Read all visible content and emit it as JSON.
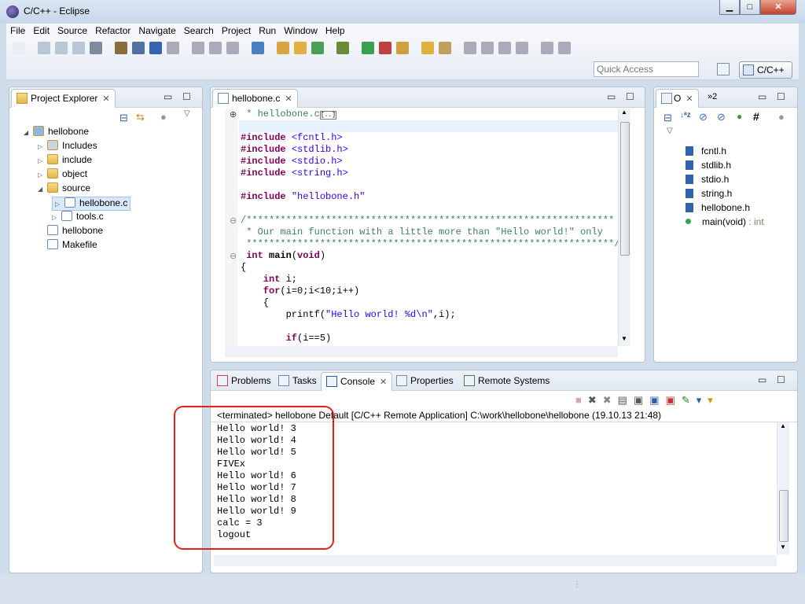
{
  "window": {
    "title": "C/C++ - Eclipse",
    "minimize": "▁",
    "maximize": "□",
    "close": "✕"
  },
  "menu": [
    "File",
    "Edit",
    "Source",
    "Refactor",
    "Navigate",
    "Search",
    "Project",
    "Run",
    "Window",
    "Help"
  ],
  "toolbar": {
    "quick_access_placeholder": "Quick Access",
    "perspective": "C/C++"
  },
  "project_explorer": {
    "tab": "Project Explorer",
    "items": [
      {
        "label": "hellobone",
        "level": 0,
        "expanded": true,
        "icon": "project-icon"
      },
      {
        "label": "Includes",
        "level": 1,
        "expanded": false,
        "icon": "includes-icon"
      },
      {
        "label": "include",
        "level": 1,
        "expanded": false,
        "icon": "folder-icon"
      },
      {
        "label": "object",
        "level": 1,
        "expanded": false,
        "icon": "folder-icon"
      },
      {
        "label": "source",
        "level": 1,
        "expanded": true,
        "icon": "folder-icon"
      },
      {
        "label": "hellobone.c",
        "level": 2,
        "expanded": false,
        "icon": "c-file-icon",
        "selected": true
      },
      {
        "label": "tools.c",
        "level": 2,
        "expanded": false,
        "icon": "c-file-icon"
      },
      {
        "label": "hellobone",
        "level": 1,
        "icon": "binary-icon"
      },
      {
        "label": "Makefile",
        "level": 1,
        "icon": "makefile-icon"
      }
    ]
  },
  "editor": {
    "tab": "hellobone.c",
    "lines": [
      [
        [
          "cm",
          " * hellobone.c"
        ],
        [
          "pl",
          "[..]"
        ]
      ],
      [],
      [
        [
          "pre",
          "#include "
        ],
        [
          "str",
          "<fcntl.h>"
        ]
      ],
      [
        [
          "pre",
          "#include "
        ],
        [
          "str",
          "<stdlib.h>"
        ]
      ],
      [
        [
          "pre",
          "#include "
        ],
        [
          "str",
          "<stdio.h>"
        ]
      ],
      [
        [
          "pre",
          "#include "
        ],
        [
          "str",
          "<string.h>"
        ]
      ],
      [],
      [
        [
          "pre",
          "#include "
        ],
        [
          "str",
          "\"hellobone.h\""
        ]
      ],
      [],
      [
        [
          "cm",
          "/*****************************************************************"
        ]
      ],
      [
        [
          "cm",
          " * Our main function with a little more than \"Hello world!\" only"
        ]
      ],
      [
        [
          "cm",
          " *****************************************************************/"
        ]
      ],
      [
        [
          "kw",
          " int "
        ],
        [
          "fn",
          "main"
        ],
        [
          "pl",
          "("
        ],
        [
          "kw",
          "void"
        ],
        [
          "pl",
          ")"
        ]
      ],
      [
        [
          "pl",
          "{"
        ]
      ],
      [
        [
          "kw",
          "    int "
        ],
        [
          "pl",
          "i;"
        ]
      ],
      [
        [
          "kw",
          "    for"
        ],
        [
          "pl",
          "(i=0;i<10;i++)"
        ]
      ],
      [
        [
          "pl",
          "    {"
        ]
      ],
      [
        [
          "pl",
          "        printf("
        ],
        [
          "str",
          "\"Hello world! %d\\n\""
        ],
        [
          "pl",
          ",i);"
        ]
      ],
      [],
      [
        [
          "kw",
          "        if"
        ],
        [
          "pl",
          "(i==5)"
        ]
      ]
    ]
  },
  "outline": {
    "tab": "O",
    "tab2": "»2",
    "items": [
      {
        "label": "fcntl.h",
        "icon": "include-icon"
      },
      {
        "label": "stdlib.h",
        "icon": "include-icon"
      },
      {
        "label": "stdio.h",
        "icon": "include-icon"
      },
      {
        "label": "string.h",
        "icon": "include-icon"
      },
      {
        "label": "hellobone.h",
        "icon": "include-icon"
      },
      {
        "label": "main(void)",
        "suffix": " : int",
        "icon": "function-icon"
      }
    ]
  },
  "console_panel": {
    "tabs": [
      "Problems",
      "Tasks",
      "Console",
      "Properties",
      "Remote Systems"
    ],
    "active": "Console",
    "header": "<terminated> hellobone Default [C/C++ Remote Application] C:\\work\\hellobone\\hellobone (19.10.13 21:48)",
    "output": [
      "Hello world! 3",
      "Hello world! 4",
      "Hello world! 5",
      "FIVEx",
      "Hello world! 6",
      "Hello world! 7",
      "Hello world! 8",
      "Hello world! 9",
      "calc = 3",
      "logout"
    ]
  },
  "colors": {
    "annotation": "#e0201a",
    "keyword": "#7f0055",
    "string": "#2a00ff",
    "comment": "#3f7f5f"
  }
}
